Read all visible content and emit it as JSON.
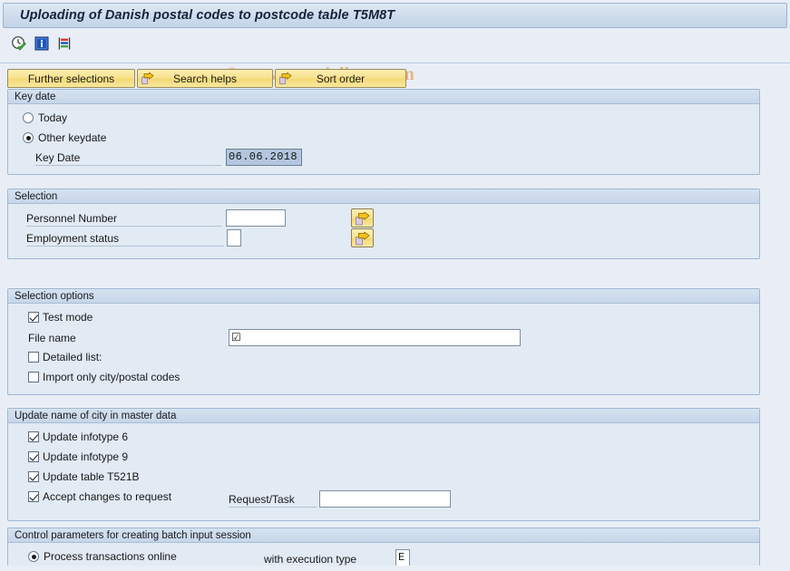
{
  "window": {
    "title": "Uploading of Danish postal codes to postcode table T5M8T"
  },
  "watermark": {
    "text": "© www.tutorialkart.com"
  },
  "toolbar": {
    "icons": [
      {
        "name": "execute-clock-check-icon",
        "title": "Execute"
      },
      {
        "name": "information-icon",
        "title": "Information"
      },
      {
        "name": "variant-list-icon",
        "title": "Get Variant"
      }
    ]
  },
  "buttons": {
    "further_selections": "Further selections",
    "search_helps": "Search helps",
    "sort_order": "Sort order"
  },
  "key_date": {
    "group_title": "Key date",
    "option_today": "Today",
    "option_other": "Other keydate",
    "selected_option": "Other keydate",
    "key_date_label": "Key Date",
    "key_date_value": "06.06.2018"
  },
  "selection": {
    "group_title": "Selection",
    "personnel_number_label": "Personnel Number",
    "personnel_number_value": "",
    "employment_status_label": "Employment status",
    "employment_status_value": ""
  },
  "selection_options": {
    "group_title": "Selection options",
    "test_mode_label": "Test mode",
    "test_mode_checked": true,
    "file_name_label": "File name",
    "file_name_value": "",
    "detailed_list_label": "Detailed list:",
    "detailed_list_checked": false,
    "import_only_label": "Import only city/postal codes",
    "import_only_checked": false
  },
  "update_city": {
    "group_title": "Update name of city in master data",
    "update_infotype_6_label": "Update infotype 6",
    "update_infotype_6_checked": true,
    "update_infotype_9_label": "Update infotype 9",
    "update_infotype_9_checked": true,
    "update_table_label": "Update table T521B",
    "update_table_checked": true,
    "accept_changes_label": "Accept changes to request",
    "accept_changes_checked": true,
    "request_task_label": "Request/Task",
    "request_task_value": ""
  },
  "control_parameters": {
    "group_title": "Control parameters for creating batch input session",
    "process_online_label": "Process transactions online",
    "process_online_selected": true,
    "execution_type_label": "with execution type",
    "execution_type_value": "E"
  },
  "colors": {
    "page_bg": "#e9eef6",
    "group_bg": "#e2eaf3",
    "group_border": "#9fb8d4",
    "button_yellow": "#f7e28c",
    "title_text": "#14243a",
    "watermark": "#e3b184",
    "selected_field": "#b3c6de"
  }
}
